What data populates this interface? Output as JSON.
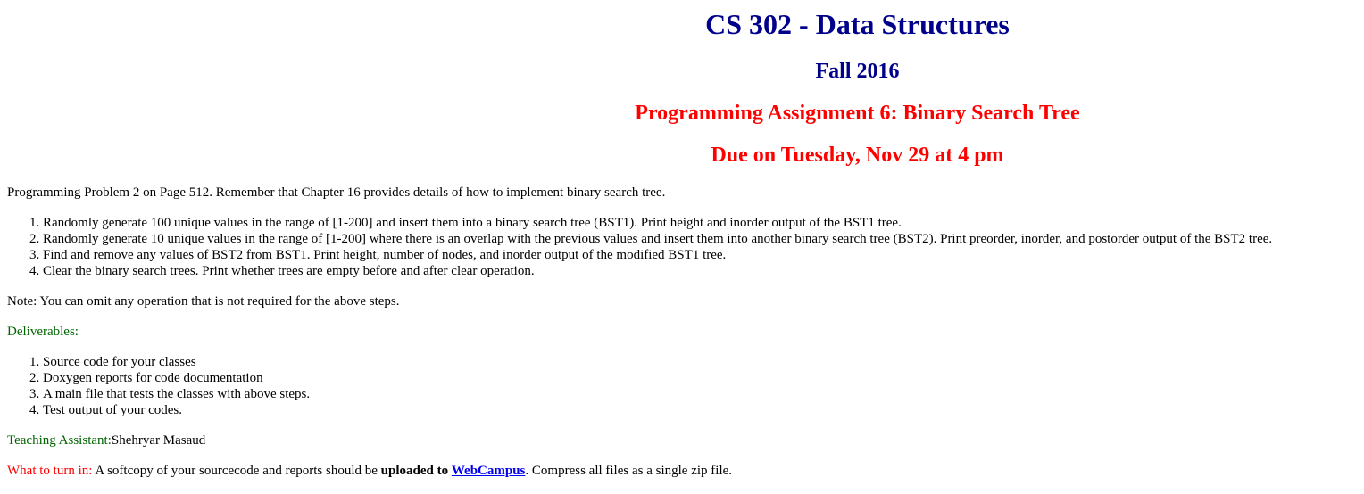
{
  "header": {
    "course": "CS 302 - Data Structures",
    "term": "Fall 2016",
    "assignment": "Programming Assignment 6: Binary Search Tree",
    "due": "Due on Tuesday, Nov 29 at 4 pm"
  },
  "intro": "Programming Problem 2 on Page 512. Remember that Chapter 16 provides details of how to implement binary search tree.",
  "steps": [
    "Randomly generate 100 unique values in the range of [1-200] and insert them into a binary search tree (BST1). Print height and inorder output of the BST1 tree.",
    "Randomly generate 10 unique values in the range of [1-200] where there is an overlap with the previous values and insert them into another binary search tree (BST2). Print preorder, inorder, and postorder output of the BST2 tree.",
    "Find and remove any values of BST2 from BST1. Print height, number of nodes, and inorder output of the modified BST1 tree.",
    "Clear the binary search trees. Print whether trees are empty before and after clear operation."
  ],
  "note": "Note: You can omit any operation that is not required for the above steps.",
  "deliverables": {
    "label": "Deliverables:",
    "items": [
      "Source code for your classes",
      "Doxygen reports for code documentation",
      "A main file that tests the classes with above steps.",
      "Test output of your codes."
    ]
  },
  "ta": {
    "label": "Teaching Assistant:",
    "name": "Shehryar Masaud"
  },
  "turnin": {
    "label": "What to turn in:",
    "text_before": " A softcopy of your sourcecode and reports should be ",
    "bold": "uploaded to",
    "space": " ",
    "link": "WebCampus",
    "text_after": ". Compress all files as a single zip file."
  },
  "colors": {
    "heading_blue": "#00008b",
    "heading_red": "#ff0000",
    "label_green": "#006400",
    "link_blue": "#0000ee"
  }
}
